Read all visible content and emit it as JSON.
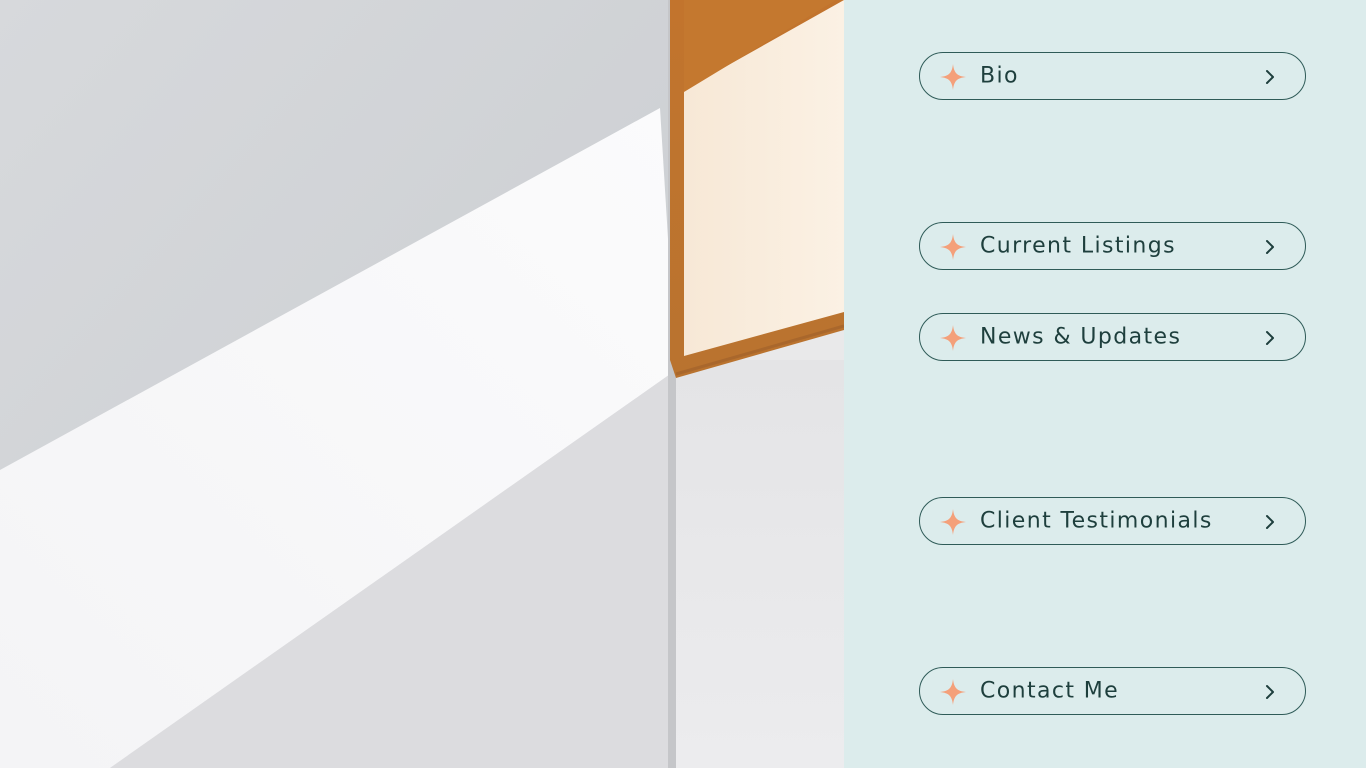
{
  "nav": {
    "items": [
      {
        "label": "Bio"
      },
      {
        "label": "Current Listings"
      },
      {
        "label": "News & Updates"
      },
      {
        "label": "Client Testimonials"
      },
      {
        "label": "Contact Me"
      }
    ]
  },
  "colors": {
    "panel_background": "#dcecec",
    "button_border": "#2f5b58",
    "label_text": "#1e3f3d",
    "star_accent": "#f4a07a"
  },
  "icons": {
    "bullet": "sparkle-star-icon",
    "arrow": "chevron-right-icon"
  }
}
